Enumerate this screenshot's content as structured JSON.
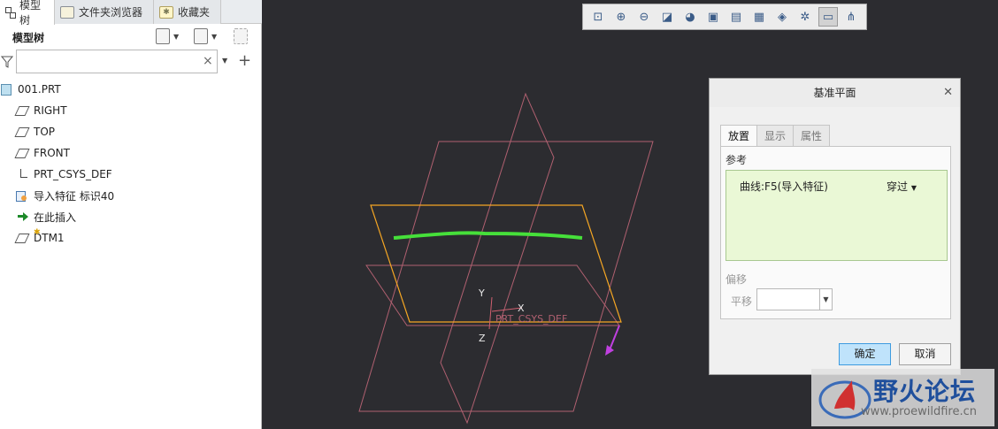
{
  "left_panel": {
    "tabs": [
      {
        "label": "模型树",
        "icon": "model-tree-icon"
      },
      {
        "label": "文件夹浏览器",
        "icon": "folder-browser-icon"
      },
      {
        "label": "收藏夹",
        "icon": "favorites-icon"
      }
    ],
    "tree_title": "模型树",
    "filter": {
      "value": "",
      "placeholder": ""
    },
    "tree_items": [
      {
        "label": "001.PRT",
        "icon": "part-icon"
      },
      {
        "label": "RIGHT",
        "icon": "datum-plane-icon"
      },
      {
        "label": "TOP",
        "icon": "datum-plane-icon"
      },
      {
        "label": "FRONT",
        "icon": "datum-plane-icon"
      },
      {
        "label": "PRT_CSYS_DEF",
        "icon": "csys-icon"
      },
      {
        "label": "导入特征 标识40",
        "icon": "import-feature-icon"
      },
      {
        "label": "在此插入",
        "icon": "insert-here-icon"
      },
      {
        "label": "DTM1",
        "icon": "datum-plane-icon"
      }
    ]
  },
  "view_toolbar": {
    "buttons": [
      "zoom-fit-icon",
      "zoom-in-icon",
      "zoom-out-icon",
      "reorient-icon",
      "saved-views-icon",
      "display-style-icon",
      "view-manager-icon",
      "perspective-icon",
      "spin-center-icon",
      "datum-display-icon",
      "annotation-display-icon",
      "sketch-view-icon"
    ],
    "pressed_index": 10
  },
  "scene": {
    "csys_label": "PRT_CSYS_DEF",
    "axis_labels": {
      "y": "Y",
      "x": "X",
      "z": "Z"
    },
    "colors": {
      "plane": "#b06070",
      "selected_plane": "#f5a623",
      "curve": "#46e03a",
      "arrow": "#c040e0"
    }
  },
  "dialog": {
    "title": "基准平面",
    "tabs": [
      "放置",
      "显示",
      "属性"
    ],
    "active_tab": 0,
    "references_label": "参考",
    "reference": {
      "item": "曲线:F5(导入特征)",
      "type": "穿过"
    },
    "offset_label": "偏移",
    "translate_label": "平移",
    "translate_value": "",
    "ok_label": "确定",
    "cancel_label": "取消"
  },
  "watermark": {
    "text": "野火论坛",
    "url": "www.proewildfire.cn"
  }
}
